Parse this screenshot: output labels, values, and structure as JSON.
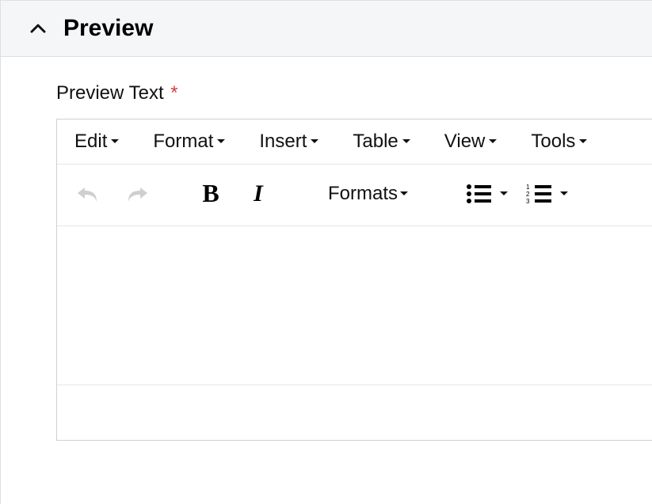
{
  "panel": {
    "title": "Preview"
  },
  "field": {
    "label": "Preview Text",
    "required_mark": "*"
  },
  "menubar": {
    "edit": "Edit",
    "format": "Format",
    "insert": "Insert",
    "table": "Table",
    "view": "View",
    "tools": "Tools"
  },
  "toolbar": {
    "formats_label": "Formats"
  }
}
